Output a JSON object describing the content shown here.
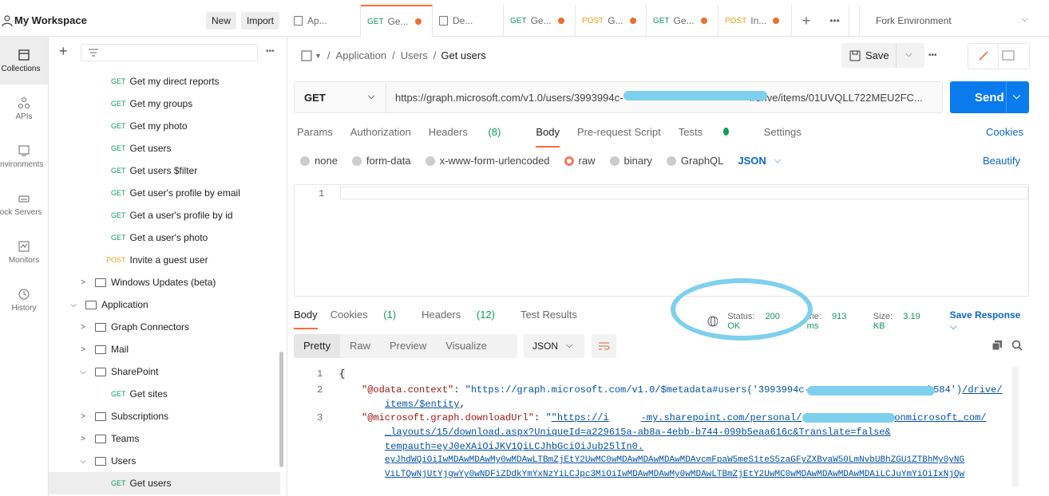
{
  "workspace": {
    "title": "My Workspace",
    "new_label": "New",
    "import_label": "Import"
  },
  "tabs": [
    {
      "method": "",
      "label": "Ap..."
    },
    {
      "method": "GET",
      "label": "Ge..."
    },
    {
      "method": "",
      "label": "De..."
    },
    {
      "method": "GET",
      "label": "Ge..."
    },
    {
      "method": "POST",
      "label": "G..."
    },
    {
      "method": "GET",
      "label": "Ge..."
    },
    {
      "method": "POST",
      "label": "In..."
    }
  ],
  "environment": "Fork Environment",
  "rail": [
    "Collections",
    "APIs",
    "Environments",
    "Mock Servers",
    "Monitors",
    "History"
  ],
  "tree": [
    {
      "type": "GET",
      "label": "Get my direct reports"
    },
    {
      "type": "GET",
      "label": "Get my groups"
    },
    {
      "type": "GET",
      "label": "Get my photo"
    },
    {
      "type": "GET",
      "label": "Get users"
    },
    {
      "type": "GET",
      "label": "Get users $filter"
    },
    {
      "type": "GET",
      "label": "Get user's profile by email"
    },
    {
      "type": "GET",
      "label": "Get a user's profile by id"
    },
    {
      "type": "GET",
      "label": "Get a user's photo"
    },
    {
      "type": "POST",
      "label": "Invite a guest user"
    },
    {
      "type": "folder",
      "label": "Windows Updates (beta)"
    },
    {
      "type": "folder",
      "label": "Application"
    },
    {
      "type": "folder",
      "label": "Graph Connectors"
    },
    {
      "type": "folder",
      "label": "Mail"
    },
    {
      "type": "folder",
      "label": "SharePoint"
    },
    {
      "type": "GET",
      "label": "Get sites"
    },
    {
      "type": "folder",
      "label": "Subscriptions"
    },
    {
      "type": "folder",
      "label": "Teams"
    },
    {
      "type": "folder",
      "label": "Users"
    },
    {
      "type": "GET",
      "label": "Get users"
    }
  ],
  "breadcrumb": {
    "a": "Application",
    "b": "Users",
    "current": "Get users"
  },
  "save_label": "Save",
  "request": {
    "method": "GET",
    "url": "https://graph.microsoft.com/v1.0/users/3993994c-",
    "url_tail": "4/drive/items/01UVQLL722MEU2FC...",
    "send_label": "Send"
  },
  "req_tabs": {
    "params": "Params",
    "auth": "Authorization",
    "headers": "Headers",
    "headers_count": "(8)",
    "body": "Body",
    "prereq": "Pre-request Script",
    "tests": "Tests",
    "settings": "Settings",
    "cookies": "Cookies"
  },
  "body_types": {
    "none": "none",
    "form": "form-data",
    "urlenc": "x-www-form-urlencoded",
    "raw": "raw",
    "binary": "binary",
    "graphql": "GraphQL",
    "json": "JSON",
    "beautify": "Beautify"
  },
  "editor": {
    "line": "1"
  },
  "response": {
    "tabs": {
      "body": "Body",
      "cookies": "Cookies",
      "cookies_count": "(1)",
      "headers": "Headers",
      "headers_count": "(12)",
      "tests": "Test Results"
    },
    "status_label": "Status:",
    "status_value": "200 OK",
    "time_label": "me:",
    "time_value": "913 ms",
    "size_label": "Size:",
    "size_value": "3.19 KB",
    "save_label": "Save Response",
    "views": {
      "pretty": "Pretty",
      "raw": "Raw",
      "preview": "Preview",
      "visualize": "Visualize"
    },
    "format": "JSON"
  },
  "code": {
    "l1": "1",
    "l2": "2",
    "l3": "3",
    "brace": "{",
    "k2": "\"@odata.context\"",
    "v2a": "\"https://graph.microsoft.com/v1.0/$metadata#users('3993994c-",
    "v2b": "1b584')",
    "v2c": "/drive/",
    "v2d": "items/$entity",
    "k3": "\"@microsoft.graph.downloadUrl\"",
    "v3a": "\"https://i",
    "v3b": "-my.sharepoint.com/personal/",
    "v3c": "onmicrosoft_com/",
    "v3d": "_layouts/15/download.aspx?UniqueId=a229615a-ab8a-4ebb-b744-099b5eaa616c&Translate=false&",
    "v3e": "tempauth=eyJ0eXAiOiJKV1QiLCJhbGciOiJub25lIn0.",
    "v3f": "eyJhdWQiOiIwMDAwMDAwMy0wMDAwLTBmZjEtY2UwMC0wMDAwMDAwMDAwMDAvcmFpaW5meS1teS5zaGFyZXBvaW50LmNvbUBhZGU1ZTBhMy0yNG",
    "v3g": "ViLTQwNjUtYjgwYy0wNDFiZDdkYmYxNzYiLCJpc3MiOiIwMDAwMDAwMy0wMDAwLTBmZjEtY2UwMC0wMDAwMDAwMDAwMDAiLCJuYmYiOiIxNjQw"
  }
}
